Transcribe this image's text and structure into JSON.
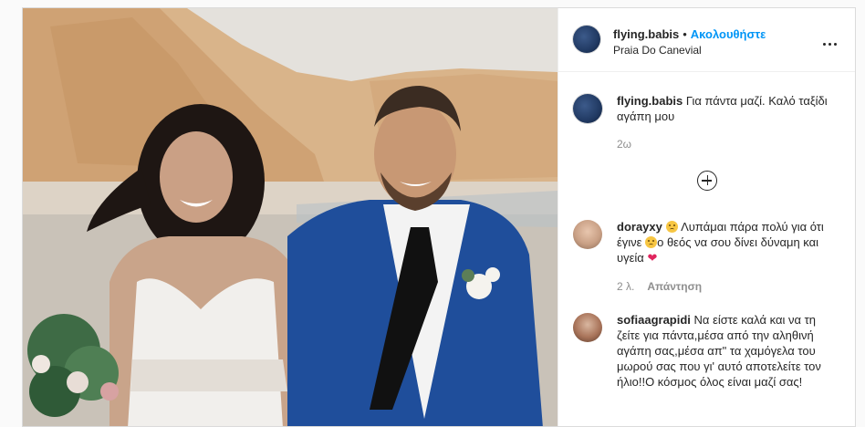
{
  "post": {
    "username": "flying.babis",
    "separator": "•",
    "follow_label": "Ακολουθήστε",
    "location": "Praia Do Canevial"
  },
  "caption": {
    "username": "flying.babis",
    "text": "Για πάντα μαζί. Καλό ταξίδι αγάπη μου",
    "time": "2ω"
  },
  "comments": [
    {
      "username": "dorayxy",
      "text_1": "Λυπάμαι πάρα πολύ για ότι έγινε",
      "text_2": "ο θεός να σου δίνει δύναμη και υγεία",
      "time": "2 λ.",
      "reply_label": "Απάντηση"
    },
    {
      "username": "sofiaagrapidi",
      "text": "Να είστε καλά και να τη ζείτε για πάντα,μέσα από την αληθινή αγάπη σας,μέσα απ\" τα χαμόγελα του μωρού σας που γι' αυτό αποτελείτε τον ήλιο!!Ο κόσμος όλος είναι μαζί σας!"
    }
  ],
  "icons": {
    "more": "more-options-icon",
    "load_more": "plus-circle-icon",
    "emoji": "sad-face-emoji",
    "heart": "red-heart-emoji"
  },
  "colors": {
    "follow": "#0095f6",
    "text": "#262626",
    "muted": "#8e8e8e"
  }
}
